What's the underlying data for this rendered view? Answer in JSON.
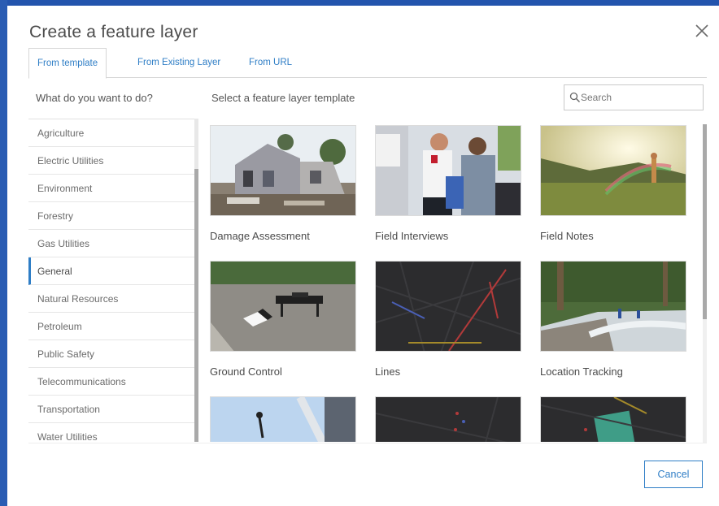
{
  "dialog": {
    "title": "Create a feature layer",
    "close_icon": "close-icon"
  },
  "tabs": [
    {
      "label": "From template",
      "active": true
    },
    {
      "label": "From Existing Layer",
      "active": false
    },
    {
      "label": "From URL",
      "active": false
    }
  ],
  "left_heading": "What do you want to do?",
  "right_heading": "Select a feature layer template",
  "search": {
    "placeholder": "Search",
    "value": "",
    "icon": "search-icon"
  },
  "categories": [
    {
      "label": "Agriculture"
    },
    {
      "label": "Electric Utilities"
    },
    {
      "label": "Environment"
    },
    {
      "label": "Forestry"
    },
    {
      "label": "Gas Utilities"
    },
    {
      "label": "General",
      "selected": true
    },
    {
      "label": "Natural Resources"
    },
    {
      "label": "Petroleum"
    },
    {
      "label": "Public Safety"
    },
    {
      "label": "Telecommunications"
    },
    {
      "label": "Transportation"
    },
    {
      "label": "Water Utilities"
    }
  ],
  "templates": [
    {
      "label": "Damage Assessment"
    },
    {
      "label": "Field Interviews"
    },
    {
      "label": "Field Notes"
    },
    {
      "label": "Ground Control"
    },
    {
      "label": "Lines"
    },
    {
      "label": "Location Tracking"
    },
    {
      "label": ""
    },
    {
      "label": ""
    },
    {
      "label": ""
    }
  ],
  "footer": {
    "cancel_label": "Cancel"
  },
  "colors": {
    "accent": "#2f7ec6",
    "frame": "#1f4fa3"
  }
}
